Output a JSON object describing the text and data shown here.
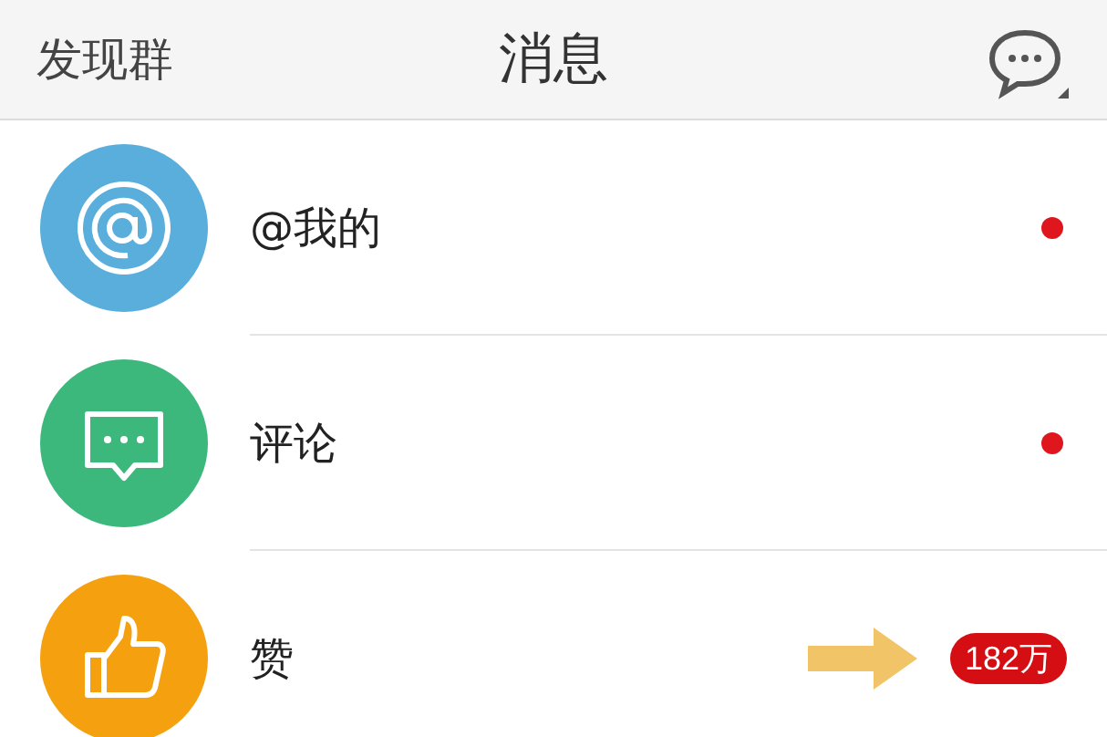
{
  "header": {
    "left": "发现群",
    "title": "消息"
  },
  "items": [
    {
      "kind": "mention",
      "label": "@我的",
      "color": "#5aaedc",
      "unread": true,
      "highlighted": false
    },
    {
      "kind": "comment",
      "label": "评论",
      "color": "#3db87d",
      "unread": true,
      "highlighted": false
    },
    {
      "kind": "like",
      "label": "赞",
      "color": "#f5a00f",
      "unread": false,
      "badge": "182万",
      "highlighted": true
    }
  ]
}
